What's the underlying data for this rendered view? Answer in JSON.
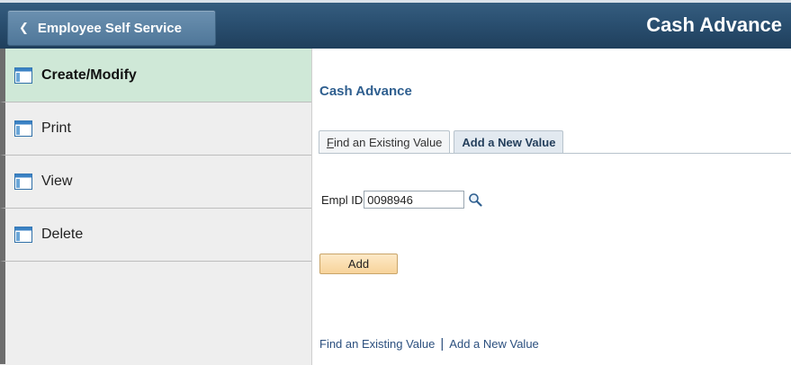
{
  "header": {
    "back_label": "Employee Self Service",
    "title": "Cash Advance",
    "back_icon": "chevron-left-icon"
  },
  "sidebar": {
    "items": [
      {
        "label": "Create/Modify",
        "active": true
      },
      {
        "label": "Print",
        "active": false
      },
      {
        "label": "View",
        "active": false
      },
      {
        "label": "Delete",
        "active": false
      }
    ]
  },
  "main": {
    "section_title": "Cash Advance",
    "tabs": [
      {
        "label_prefix": "F",
        "label_rest": "ind an Existing Value",
        "active": false
      },
      {
        "label": "Add a New Value",
        "active": true
      }
    ],
    "empl_id_label": "Empl ID",
    "empl_id_value": "0098946",
    "add_button": "Add",
    "bottom_links": {
      "find": "Find an Existing Value",
      "separator": "|",
      "add": "Add a New Value"
    }
  },
  "colors": {
    "header": "#2a4f70",
    "active_nav": "#cfe8d7",
    "link": "#2b4f7e",
    "add_button": "#f7d39a"
  }
}
